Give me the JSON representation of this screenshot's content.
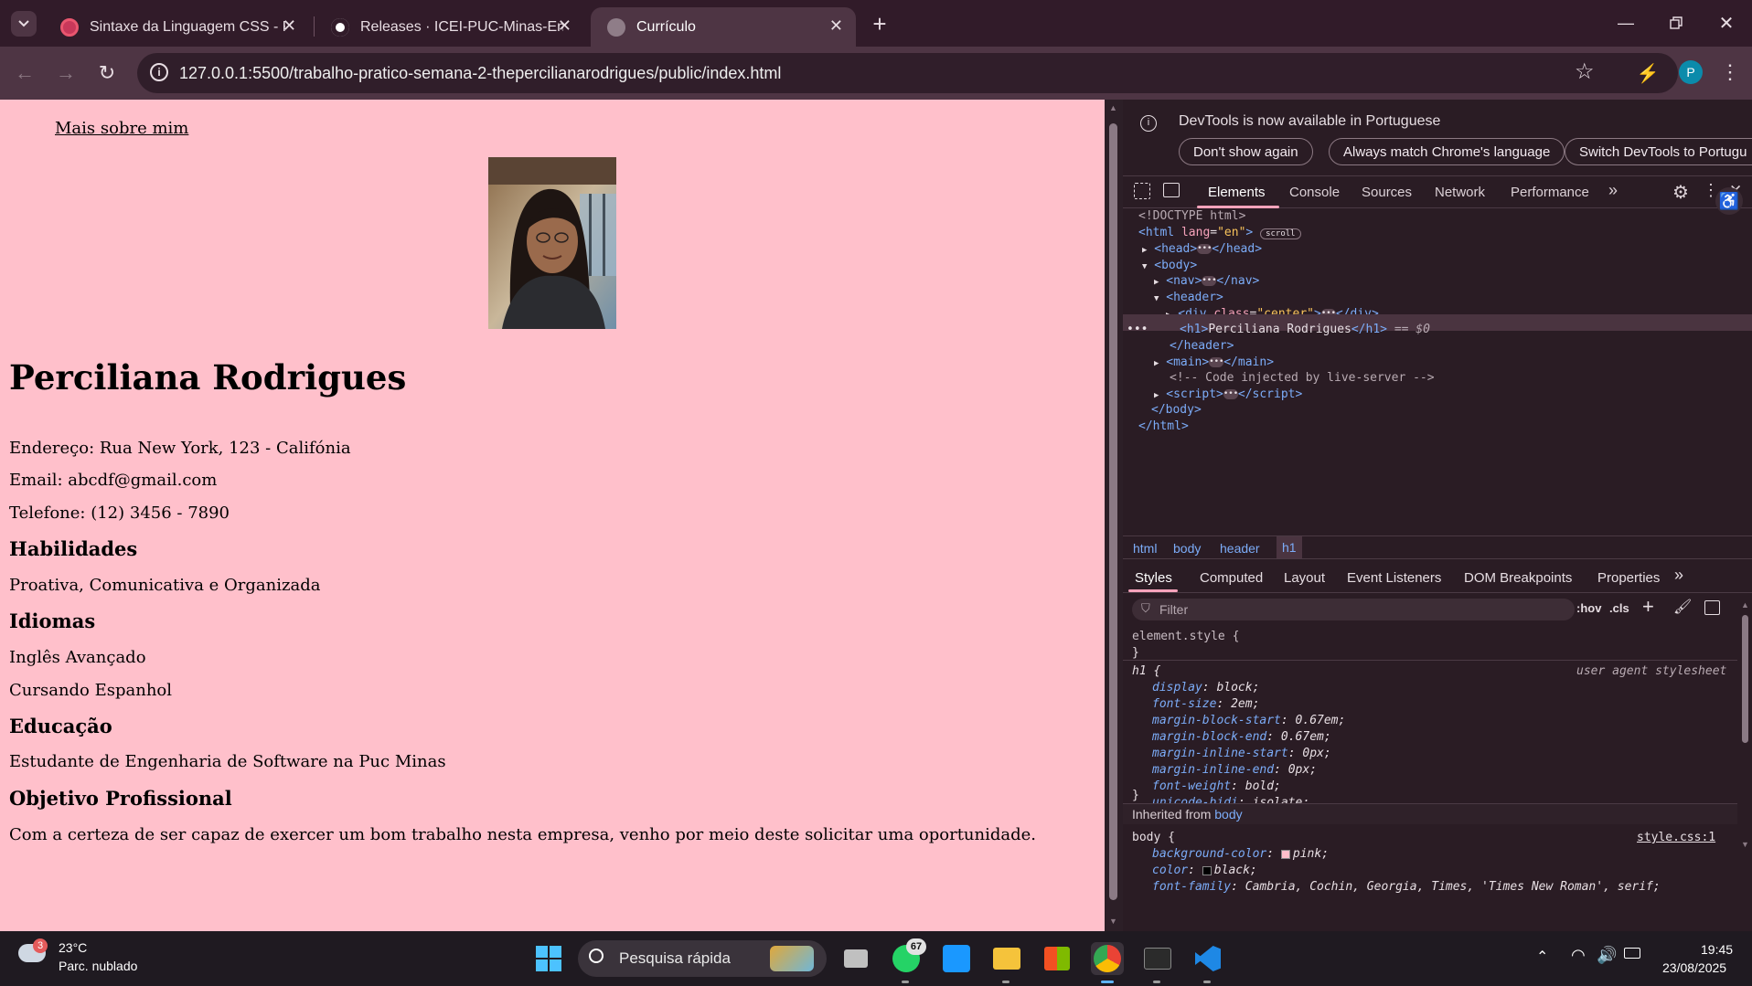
{
  "browser": {
    "tabs": [
      {
        "title": "Sintaxe da Linguagem CSS - Re",
        "icon": "css-icon"
      },
      {
        "title": "Releases · ICEI-PUC-Minas-EngS",
        "icon": "github-icon"
      },
      {
        "title": "Currículo",
        "icon": "globe-icon"
      }
    ],
    "url": "127.0.0.1:5500/trabalho-pratico-semana-2-thepercilianarodrigues/public/index.html",
    "profile_initial": "P"
  },
  "page": {
    "nav_link": "Mais sobre mim",
    "name": "Perciliana Rodrigues",
    "address": "Endereço: Rua New York, 123 - Califónia",
    "email": "Email: abcdf@gmail.com",
    "phone": "Telefone: (12) 3456 - 7890",
    "skills_title": "Habilidades",
    "skills": "Proativa, Comunicativa e Organizada",
    "languages_title": "Idiomas",
    "language_1": "Inglês Avançado",
    "language_2": "Cursando Espanhol",
    "education_title": "Educação",
    "education": "Estudante de Engenharia de Software na Puc Minas",
    "objective_title": "Objetivo Profissional",
    "objective": "Com a certeza de ser capaz de exercer um bom trabalho nesta empresa, venho por meio deste solicitar uma oportunidade.",
    "background_color": "#ffc0cb"
  },
  "devtools": {
    "info_message": "DevTools is now available in Portuguese",
    "info_buttons": [
      "Don't show again",
      "Always match Chrome's language",
      "Switch DevTools to Portugu"
    ],
    "tabs": [
      "Elements",
      "Console",
      "Sources",
      "Network",
      "Performance"
    ],
    "dom": {
      "doctype": "<!DOCTYPE html>",
      "html_open_tag": "html",
      "html_lang_attr": "lang",
      "html_lang_val": "\"en\"",
      "scroll_badge": "scroll",
      "head": "head",
      "body": "body",
      "nav": "nav",
      "header": "header",
      "div": "div",
      "div_class_attr": "class",
      "div_class_val": "\"center\"",
      "h1": "h1",
      "h1_text": "Perciliana Rodrigues",
      "h1_marker": "== $0",
      "main": "main",
      "comment": "<!-- Code injected by live-server -->",
      "script": "script"
    },
    "breadcrumbs": [
      "html",
      "body",
      "header",
      "h1"
    ],
    "sub_tabs": [
      "Styles",
      "Computed",
      "Layout",
      "Event Listeners",
      "DOM Breakpoints",
      "Properties"
    ],
    "filter_placeholder": "Filter",
    "hov": ":hov",
    "cls": ".cls",
    "element_style": "element.style {",
    "close_brace": "}",
    "h1_rule": {
      "selector": "h1 {",
      "source": "user agent stylesheet",
      "props": [
        {
          "name": "display",
          "value": "block;"
        },
        {
          "name": "font-size",
          "value": "2em;"
        },
        {
          "name": "margin-block-start",
          "value": "0.67em;"
        },
        {
          "name": "margin-block-end",
          "value": "0.67em;"
        },
        {
          "name": "margin-inline-start",
          "value": "0px;"
        },
        {
          "name": "margin-inline-end",
          "value": "0px;"
        },
        {
          "name": "font-weight",
          "value": "bold;"
        },
        {
          "name": "unicode-bidi",
          "value": "isolate;"
        }
      ]
    },
    "inherited_label": "Inherited from",
    "inherited_from": "body",
    "body_rule": {
      "selector": "body {",
      "source": "style.css:1",
      "props": [
        {
          "name": "background-color",
          "value": "pink;"
        },
        {
          "name": "color",
          "value": "black;"
        },
        {
          "name": "font-family",
          "value": "Cambria, Cochin, Georgia, Times, 'Times New Roman', serif;"
        }
      ]
    }
  },
  "taskbar": {
    "temperature": "23°C",
    "weather": "Parc. nublado",
    "weather_badge": "3",
    "search_placeholder": "Pesquisa rápida",
    "whatsapp_badge": "67",
    "time": "19:45",
    "date": "23/08/2025"
  }
}
